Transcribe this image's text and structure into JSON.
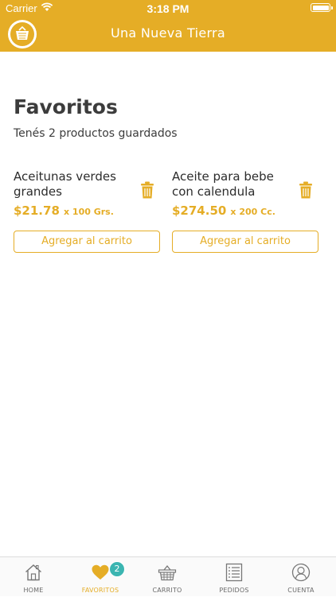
{
  "status_bar": {
    "carrier": "Carrier",
    "time": "3:18 PM"
  },
  "header": {
    "title": "Una Nueva Tierra"
  },
  "favorites": {
    "title": "Favoritos",
    "subtitle": "Tenés 2 productos guardados",
    "products": [
      {
        "name": "Aceitunas verdes grandes",
        "price": "$21.78",
        "unit": "x 100 Grs.",
        "add_label": "Agregar al carrito"
      },
      {
        "name": "Aceite para bebe con calendula",
        "price": "$274.50",
        "unit": "x 200 Cc.",
        "add_label": "Agregar al carrito"
      }
    ]
  },
  "tabbar": {
    "items": [
      {
        "label": "HOME",
        "icon": "home-icon"
      },
      {
        "label": "FAVORITOS",
        "icon": "heart-icon",
        "badge": "2",
        "active": true
      },
      {
        "label": "CARRITO",
        "icon": "basket-icon"
      },
      {
        "label": "PEDIDOS",
        "icon": "list-icon"
      },
      {
        "label": "CUENTA",
        "icon": "user-icon"
      }
    ]
  },
  "colors": {
    "accent": "#e5ad26",
    "badge": "#3bb5b1",
    "text": "#3c3c3c"
  }
}
